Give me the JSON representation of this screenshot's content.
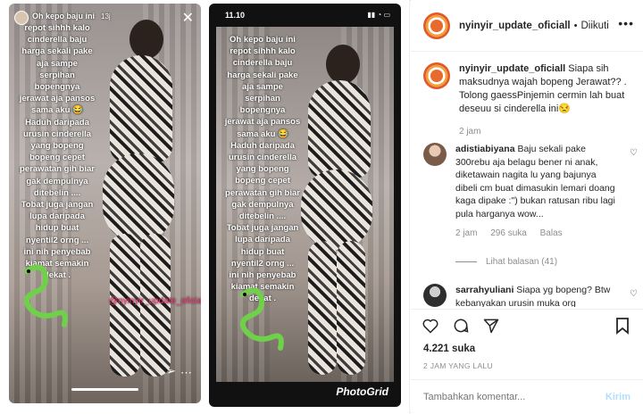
{
  "post": {
    "username": "nyinyir_update_oficiall",
    "follow_status": "Diikuti",
    "caption_text": "Siapa sih maksudnya wajah bopeng Jerawat?? . Tolong gaessPinjemin cermin lah buat deseuu si cinderella ini😒",
    "caption_time": "2 jam",
    "likes": "4.221 suka",
    "time_ago": "2 JAM YANG LALU",
    "comment_placeholder": "Tambahkan komentar...",
    "post_label": "Kirim"
  },
  "comments": [
    {
      "username": "adistiabiyana",
      "text": "Baju sekali pake 300rebu aja belagu bener ni anak, diketawain nagita lu yang bajunya dibeli cm buat dimasukin lemari doang kaga dipake :\") bukan ratusan ribu lagi pula harganya wow...",
      "time": "2 jam",
      "likes": "296 suka",
      "reply": "Balas",
      "view_replies": "Lihat balasan (41)"
    },
    {
      "username": "sarrahyuliani",
      "text": "Siapa yg bopeng? Btw kebanyakan urusin muka org",
      "time": "",
      "likes": "",
      "reply": ""
    }
  ],
  "story_left": {
    "header_text": "Oh kepo baju ini",
    "timestamp": "13j",
    "text": "repot sihhh kalo\ncinderella baju\nharga sekali pake\naja sampe\nserpihan\nbopengnya\njerawat aja pansos\nsama aku 😂\nHaduh daripada\nurusin cinderella\nyang bopeng\nbopeng cepet\nperawatan gih biar\ngak dempulnya\nditebelin ....\nTobat juga jangan\nlupa daripada\nhidup buat\nnyentil2 orng ...\nini nih penyebab\nkiamat semakin\ndekat .",
    "watermark": "@nyinyir_update_oficiall"
  },
  "story_right": {
    "status_time": "11.10",
    "text": "Oh kepo baju ini\nrepot sihhh kalo\ncinderella baju\nharga sekali pake\naja sampe\nserpihan\nbopengnya\njerawat aja pansos\nsama aku 😂\nHaduh daripada\nurusin cinderella\nyang bopeng\nbopeng cepet\nperawatan gih biar\ngak dempulnya\nditebelin ....\nTobat juga jangan\nlupa daripada\nhidup buat\nnyentil2 orng ...\nini nih penyebab\nkiamat semakin\ndekat .",
    "watermark": "PhotoGrid"
  },
  "icons": [
    "close-icon",
    "send-icon",
    "more-icon",
    "heart-icon",
    "comment-icon",
    "share-icon",
    "bookmark-icon"
  ]
}
